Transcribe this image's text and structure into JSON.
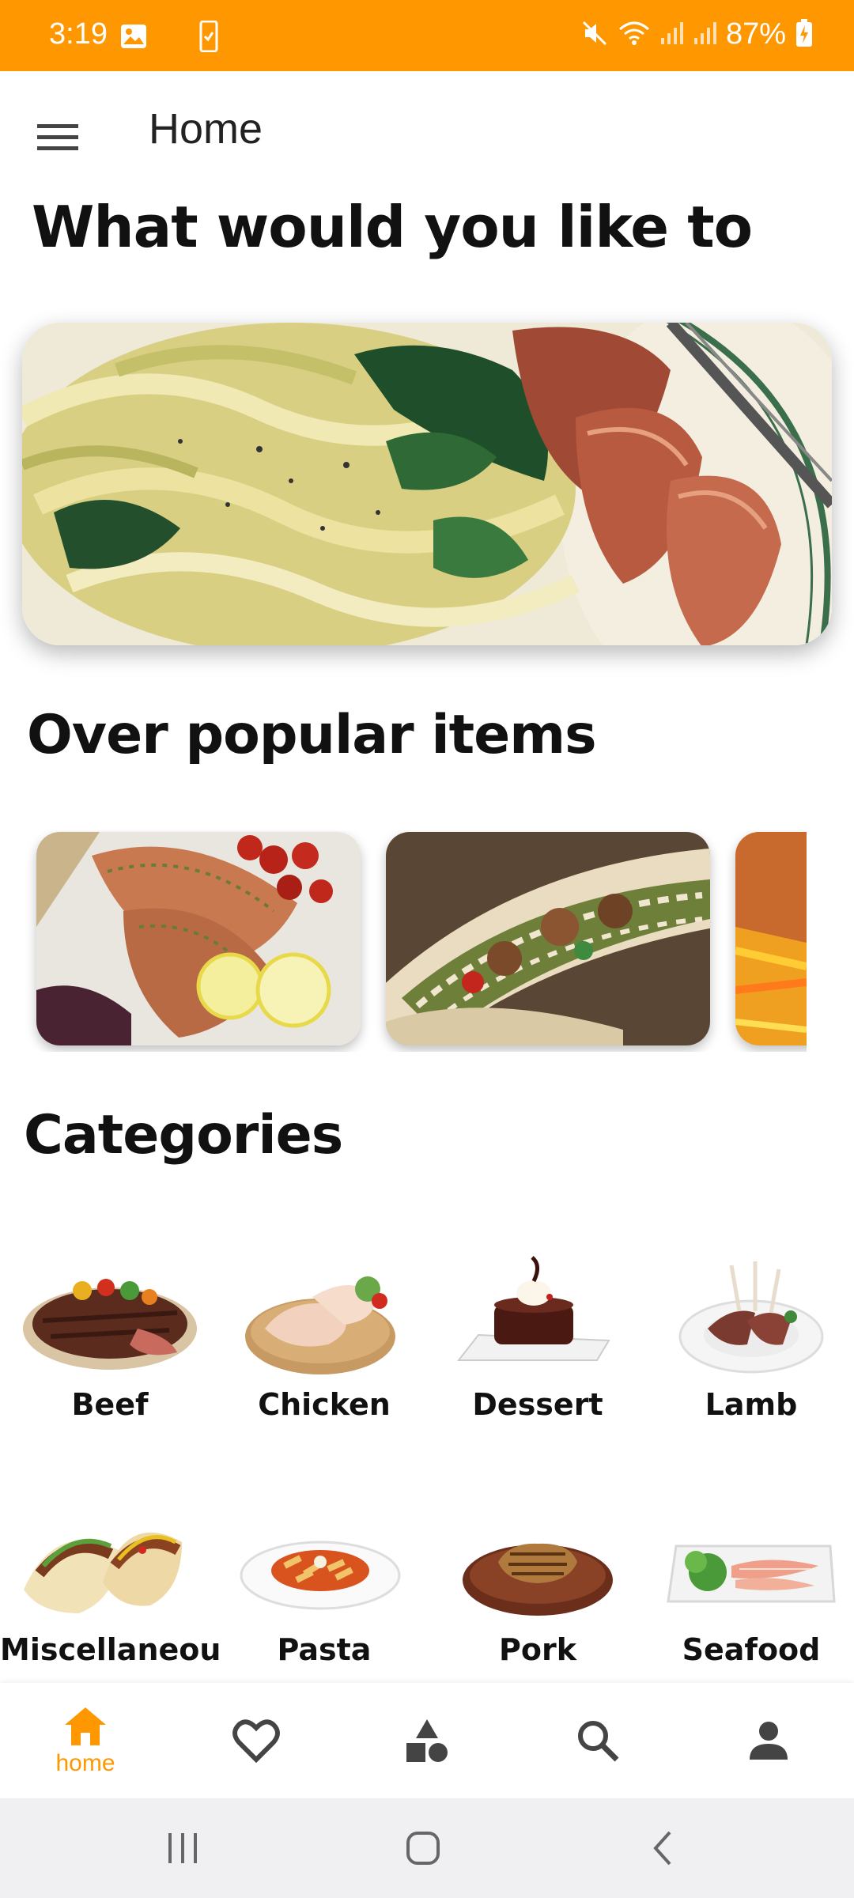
{
  "status_bar": {
    "time": "3:19",
    "battery": "87%",
    "background_color": "#ff9800",
    "icons": [
      "image-icon",
      "phone-check-icon",
      "mute-icon",
      "wifi-icon",
      "signal-icon",
      "signal-icon",
      "battery-charging-icon"
    ]
  },
  "app_bar": {
    "title": "Home",
    "menu_icon": "hamburger-menu-icon"
  },
  "headline": "What would you like to",
  "sections": {
    "popular_title": "Over popular items",
    "categories_title": "Categories"
  },
  "categories": [
    {
      "label": "Beef"
    },
    {
      "label": "Chicken"
    },
    {
      "label": "Dessert"
    },
    {
      "label": "Lamb"
    },
    {
      "label": "Miscellaneou"
    },
    {
      "label": "Pasta"
    },
    {
      "label": "Pork"
    },
    {
      "label": "Seafood"
    }
  ],
  "bottom_nav": {
    "items": [
      {
        "label": "home",
        "icon": "home-icon",
        "active": true
      },
      {
        "label": "",
        "icon": "heart-icon"
      },
      {
        "label": "",
        "icon": "category-shapes-icon"
      },
      {
        "label": "",
        "icon": "search-icon"
      },
      {
        "label": "",
        "icon": "person-icon"
      }
    ],
    "accent_color": "#ff9800"
  },
  "system_nav": {
    "icons": [
      "recents-icon",
      "home-circle-icon",
      "back-icon"
    ]
  }
}
